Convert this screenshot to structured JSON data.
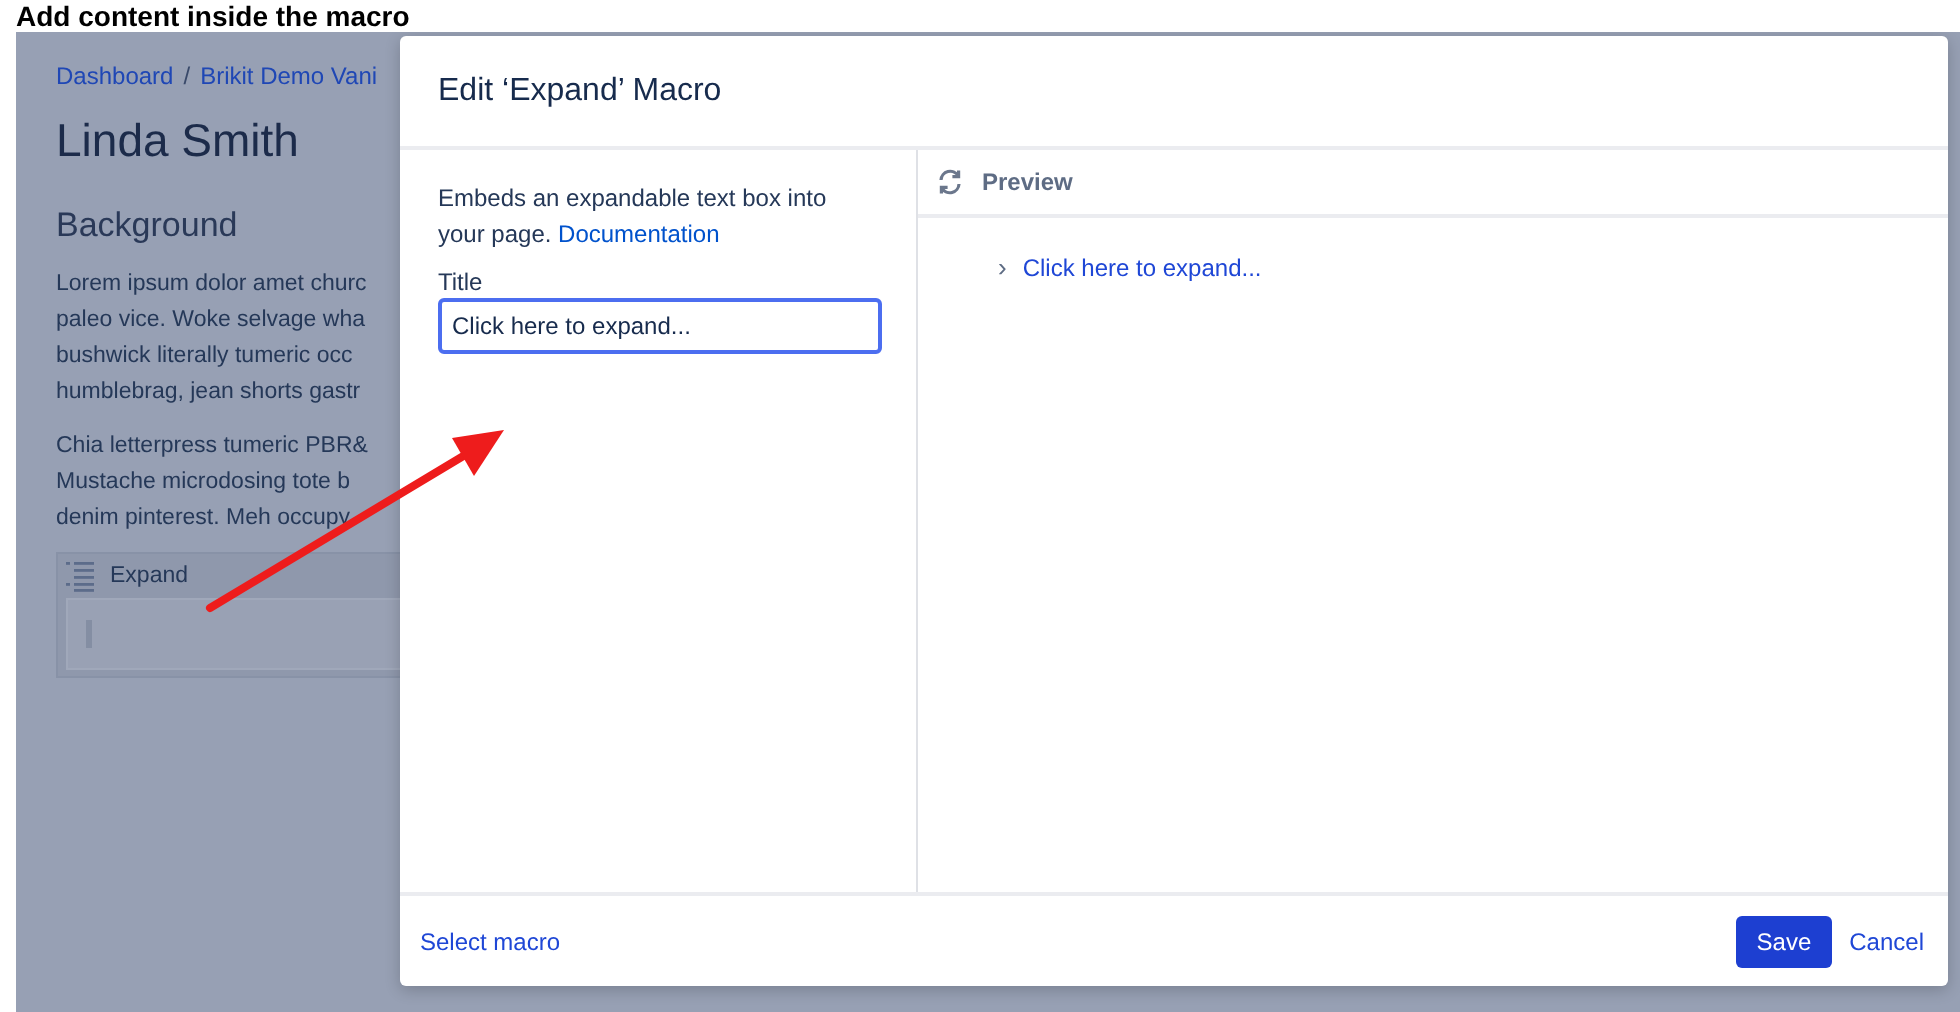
{
  "caption": "Add content inside the macro",
  "page": {
    "breadcrumbs": [
      "Dashboard",
      "Brikit Demo Vani"
    ],
    "breadcrumb_separator": "/",
    "title": "Linda Smith",
    "heading": "Background",
    "paragraphs": [
      [
        "Lorem ipsum dolor amet churc",
        "paleo vice. Woke selvage wha",
        "bushwick literally tumeric occ",
        "humblebrag, jean shorts gastr"
      ],
      [
        "Chia letterpress tumeric PBR&",
        "Mustache microdosing tote b",
        "denim pinterest. Meh occupy"
      ]
    ],
    "macro": {
      "label": "Expand"
    }
  },
  "dialog": {
    "title": "Edit ‘Expand’ Macro",
    "description": "Embeds an expandable text box into your page.",
    "doc_link": "Documentation",
    "field": {
      "label": "Title",
      "value": "Click here to expand..."
    },
    "preview": {
      "label": "Preview",
      "link": "Click here to expand...",
      "chevron": "›"
    },
    "footer": {
      "select": "Select macro",
      "save": "Save",
      "cancel": "Cancel"
    }
  }
}
